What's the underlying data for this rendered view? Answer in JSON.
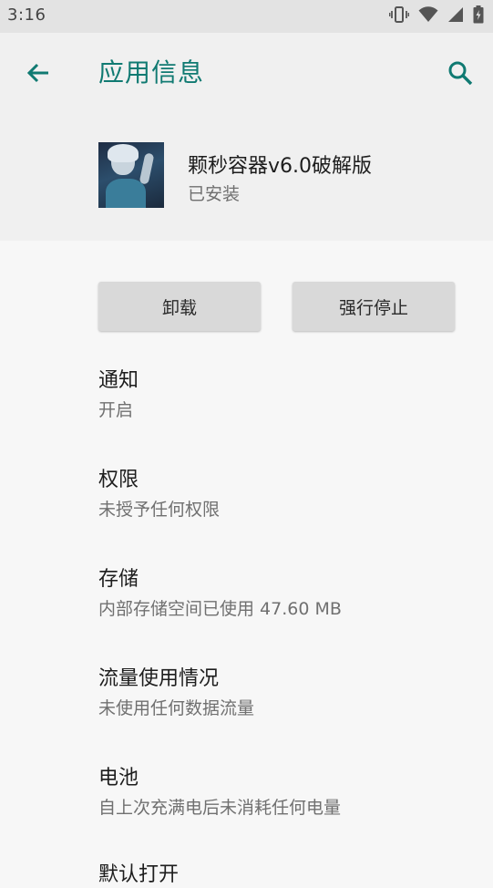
{
  "status_bar": {
    "time": "3:16",
    "icons": [
      "vibrate-icon",
      "wifi-icon",
      "signal-icon",
      "battery-charging-icon"
    ]
  },
  "header": {
    "back_icon": "arrow-back-icon",
    "title": "应用信息",
    "search_icon": "search-icon",
    "accent_color": "#107a72"
  },
  "app": {
    "name": "颗秒容器v6.0破解版",
    "status": "已安装"
  },
  "actions": {
    "uninstall_label": "卸载",
    "force_stop_label": "强行停止"
  },
  "settings": [
    {
      "title": "通知",
      "summary": "开启"
    },
    {
      "title": "权限",
      "summary": "未授予任何权限"
    },
    {
      "title": "存储",
      "summary": "内部存储空间已使用 47.60 MB"
    },
    {
      "title": "流量使用情况",
      "summary": "未使用任何数据流量"
    },
    {
      "title": "电池",
      "summary": "自上次充满电后未消耗任何电量"
    },
    {
      "title": "默认打开",
      "summary": ""
    }
  ]
}
